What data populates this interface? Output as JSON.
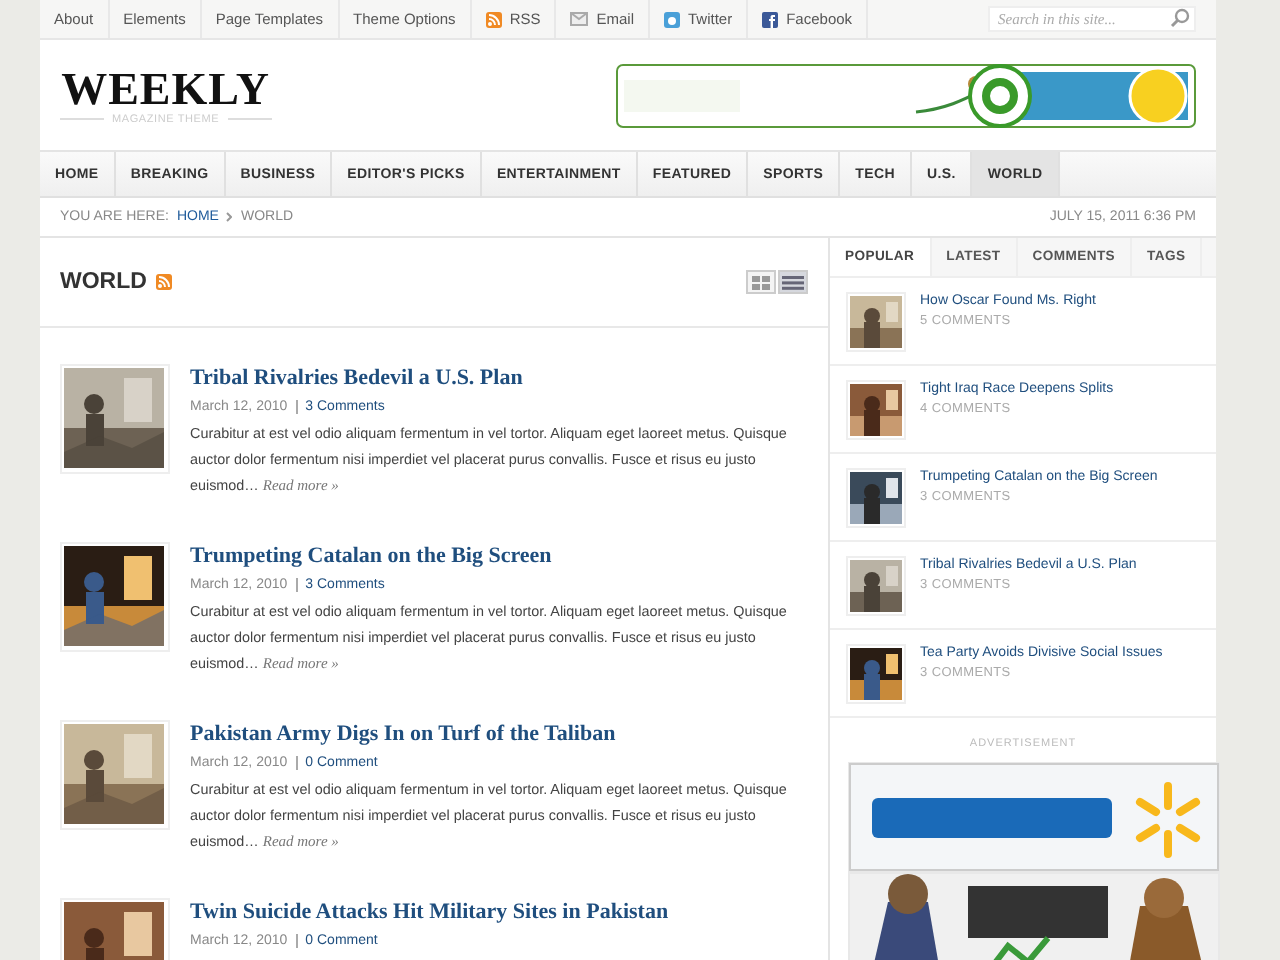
{
  "top_bar": {
    "links": [
      {
        "label": "About",
        "kind": "plain"
      },
      {
        "label": "Elements",
        "kind": "plain"
      },
      {
        "label": "Page Templates",
        "kind": "plain"
      },
      {
        "label": "Theme Options",
        "kind": "plain"
      },
      {
        "label": "RSS",
        "kind": "rss"
      },
      {
        "label": "Email",
        "kind": "email"
      },
      {
        "label": "Twitter",
        "kind": "twitter"
      },
      {
        "label": "Facebook",
        "kind": "facebook"
      }
    ],
    "search": {
      "placeholder": "Search in this site..."
    }
  },
  "logo": {
    "title": "WEEKLY",
    "tagline": "MAGAZINE THEME"
  },
  "nav": [
    {
      "label": "HOME",
      "selected": false
    },
    {
      "label": "BREAKING",
      "selected": false
    },
    {
      "label": "BUSINESS",
      "selected": false
    },
    {
      "label": "EDITOR'S PICKS",
      "selected": false
    },
    {
      "label": "ENTERTAINMENT",
      "selected": false
    },
    {
      "label": "FEATURED",
      "selected": false
    },
    {
      "label": "SPORTS",
      "selected": false
    },
    {
      "label": "TECH",
      "selected": false
    },
    {
      "label": "U.S.",
      "selected": false
    },
    {
      "label": "WORLD",
      "selected": true
    }
  ],
  "breadcrumb": {
    "prefix": "YOU ARE HERE:",
    "items": [
      {
        "label": "HOME",
        "kind": "link"
      },
      {
        "label": "WORLD",
        "kind": "current"
      }
    ],
    "date": "JULY 15, 2011 6:36 PM"
  },
  "section": {
    "title": "WORLD",
    "view_modes": [
      {
        "kind": "grid",
        "selected": false
      },
      {
        "kind": "list",
        "selected": true
      }
    ]
  },
  "posts": [
    {
      "title": "Tribal Rivalries Bedevil a U.S. Plan",
      "date": "March 12, 2010",
      "comments": "3 Comments",
      "excerpt": "Curabitur at est vel odio aliquam fermentum in vel tortor. Aliquam eget laoreet metus. Quisque auctor dolor fermentum nisi imperdiet vel placerat purus convallis. Fusce et risus eu justo euismod…",
      "read_more": "Read more »"
    },
    {
      "title": "Trumpeting Catalan on the Big Screen",
      "date": "March 12, 2010",
      "comments": "3 Comments",
      "excerpt": "Curabitur at est vel odio aliquam fermentum in vel tortor. Aliquam eget laoreet metus. Quisque auctor dolor fermentum nisi imperdiet vel placerat purus convallis. Fusce et risus eu justo euismod…",
      "read_more": "Read more »"
    },
    {
      "title": "Pakistan Army Digs In on Turf of the Taliban",
      "date": "March 12, 2010",
      "comments": "0 Comment",
      "excerpt": "Curabitur at est vel odio aliquam fermentum in vel tortor. Aliquam eget laoreet metus. Quisque auctor dolor fermentum nisi imperdiet vel placerat purus convallis. Fusce et risus eu justo euismod…",
      "read_more": "Read more »"
    },
    {
      "title": "Twin Suicide Attacks Hit Military Sites in Pakistan",
      "date": "March 12, 2010",
      "comments": "0 Comment"
    }
  ],
  "sidebar": {
    "tabs": [
      {
        "label": "POPULAR",
        "selected": true
      },
      {
        "label": "LATEST",
        "selected": false
      },
      {
        "label": "COMMENTS",
        "selected": false
      },
      {
        "label": "TAGS",
        "selected": false
      }
    ],
    "items": [
      {
        "title": "How Oscar Found Ms. Right",
        "comments": "5 COMMENTS"
      },
      {
        "title": "Tight Iraq Race Deepens Splits",
        "comments": "4 COMMENTS"
      },
      {
        "title": "Trumpeting Catalan on the Big Screen",
        "comments": "3 COMMENTS"
      },
      {
        "title": "Tribal Rivalries Bedevil a U.S. Plan",
        "comments": "3 COMMENTS"
      },
      {
        "title": "Tea Party Avoids Divisive Social Issues",
        "comments": "3 COMMENTS"
      }
    ],
    "ad_label": "ADVERTISEMENT"
  }
}
